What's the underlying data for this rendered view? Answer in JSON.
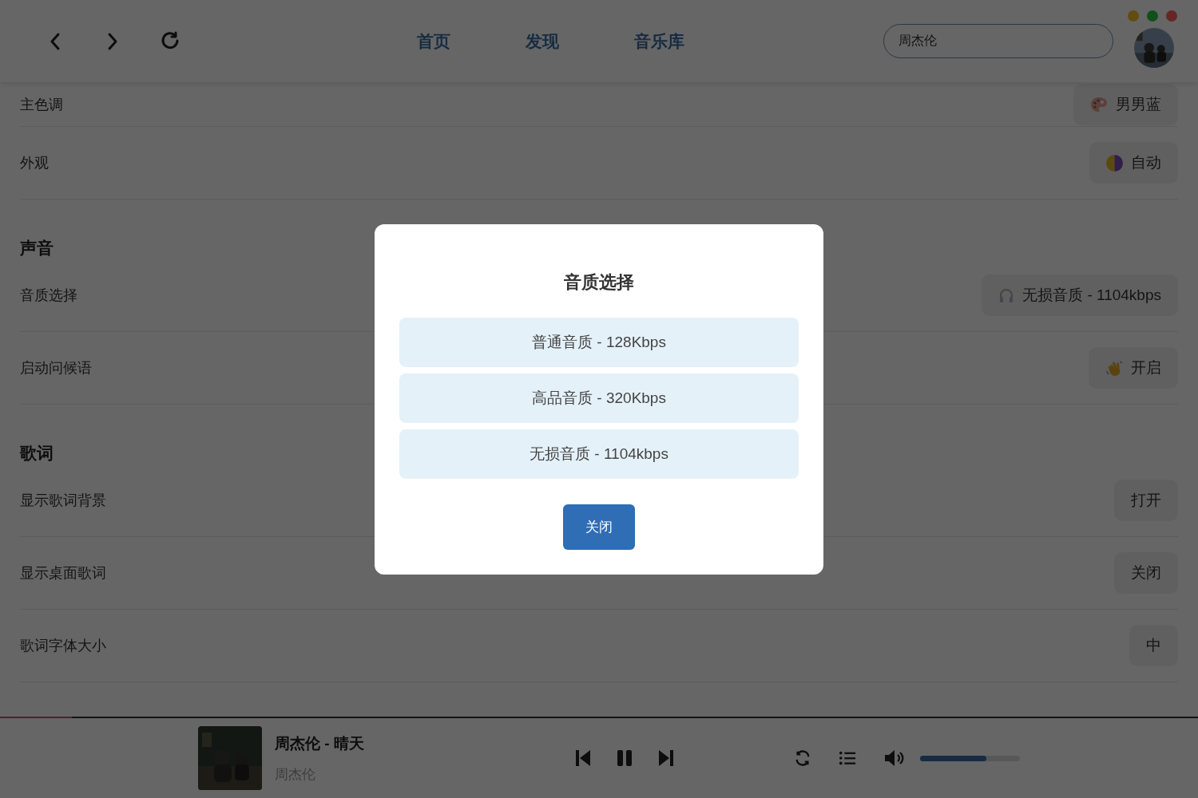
{
  "header": {
    "nav": [
      "首页",
      "发现",
      "音乐库"
    ],
    "search": {
      "value": "周杰伦"
    }
  },
  "general": [
    {
      "label": "主色调",
      "value": "男男蓝",
      "kind": "palette"
    },
    {
      "label": "外观",
      "value": "自动",
      "kind": "theme"
    }
  ],
  "sections": [
    {
      "title": "声音",
      "rows": [
        {
          "label": "音质选择",
          "value": "无损音质 - 1104kbps",
          "kind": "headphones"
        },
        {
          "label": "启动问候语",
          "value": "开启",
          "kind": "wave"
        }
      ]
    },
    {
      "title": "歌词",
      "rows": [
        {
          "label": "显示歌词背景",
          "value": "打开",
          "kind": "plain"
        },
        {
          "label": "显示桌面歌词",
          "value": "关闭",
          "kind": "plain"
        },
        {
          "label": "歌词字体大小",
          "value": "中",
          "kind": "plain"
        }
      ]
    }
  ],
  "player": {
    "progress": {
      "level": 0.06
    },
    "title": "周杰伦 - 晴天",
    "artist": "周杰伦",
    "playing": true,
    "volume": {
      "level": 0.66
    }
  },
  "dialog": {
    "title": "音质选择",
    "options": [
      "普通音质 - 128Kbps",
      "高品音质 - 320Kbps",
      "无损音质 - 1104kbps"
    ],
    "close": "关闭"
  }
}
